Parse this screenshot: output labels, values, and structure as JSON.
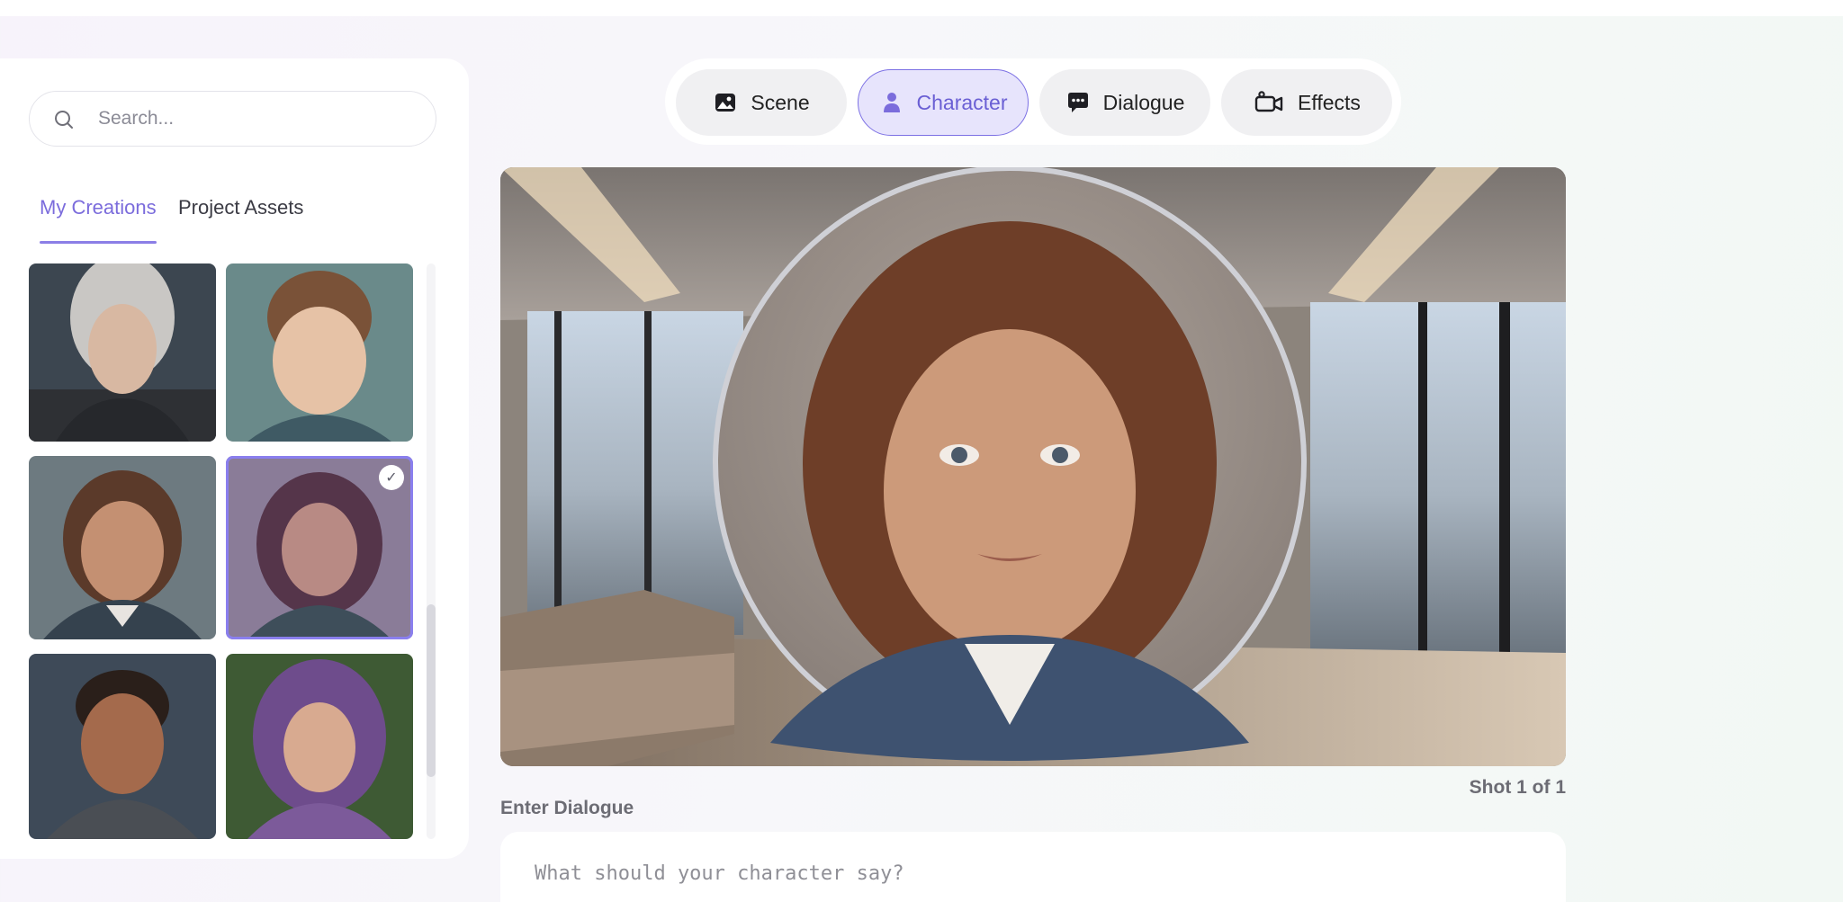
{
  "sidebar": {
    "search": {
      "placeholder": "Search..."
    },
    "tabs": [
      {
        "label": "My Creations",
        "active": true
      },
      {
        "label": "Project Assets",
        "active": false
      }
    ],
    "creations": [
      {
        "name": "white-haired-girl",
        "selected": false
      },
      {
        "name": "young-boy",
        "selected": false
      },
      {
        "name": "elderly-woman",
        "selected": false
      },
      {
        "name": "brown-haired-woman",
        "selected": true
      },
      {
        "name": "young-man-in-rain",
        "selected": false
      },
      {
        "name": "purple-haired-girl",
        "selected": false
      }
    ]
  },
  "toolbar": {
    "buttons": [
      {
        "label": "Scene",
        "icon": "image-icon",
        "active": false
      },
      {
        "label": "Character",
        "icon": "person-icon",
        "active": true
      },
      {
        "label": "Dialogue",
        "icon": "chat-bubble-icon",
        "active": false
      },
      {
        "label": "Effects",
        "icon": "camera-icon",
        "active": false
      }
    ]
  },
  "stage": {
    "shot_label": "Shot 1 of 1"
  },
  "dialogue": {
    "label": "Enter Dialogue",
    "placeholder": "What should your character say?"
  },
  "colors": {
    "accent": "#7b6cdc",
    "accent_bg": "#e7e4fc"
  }
}
